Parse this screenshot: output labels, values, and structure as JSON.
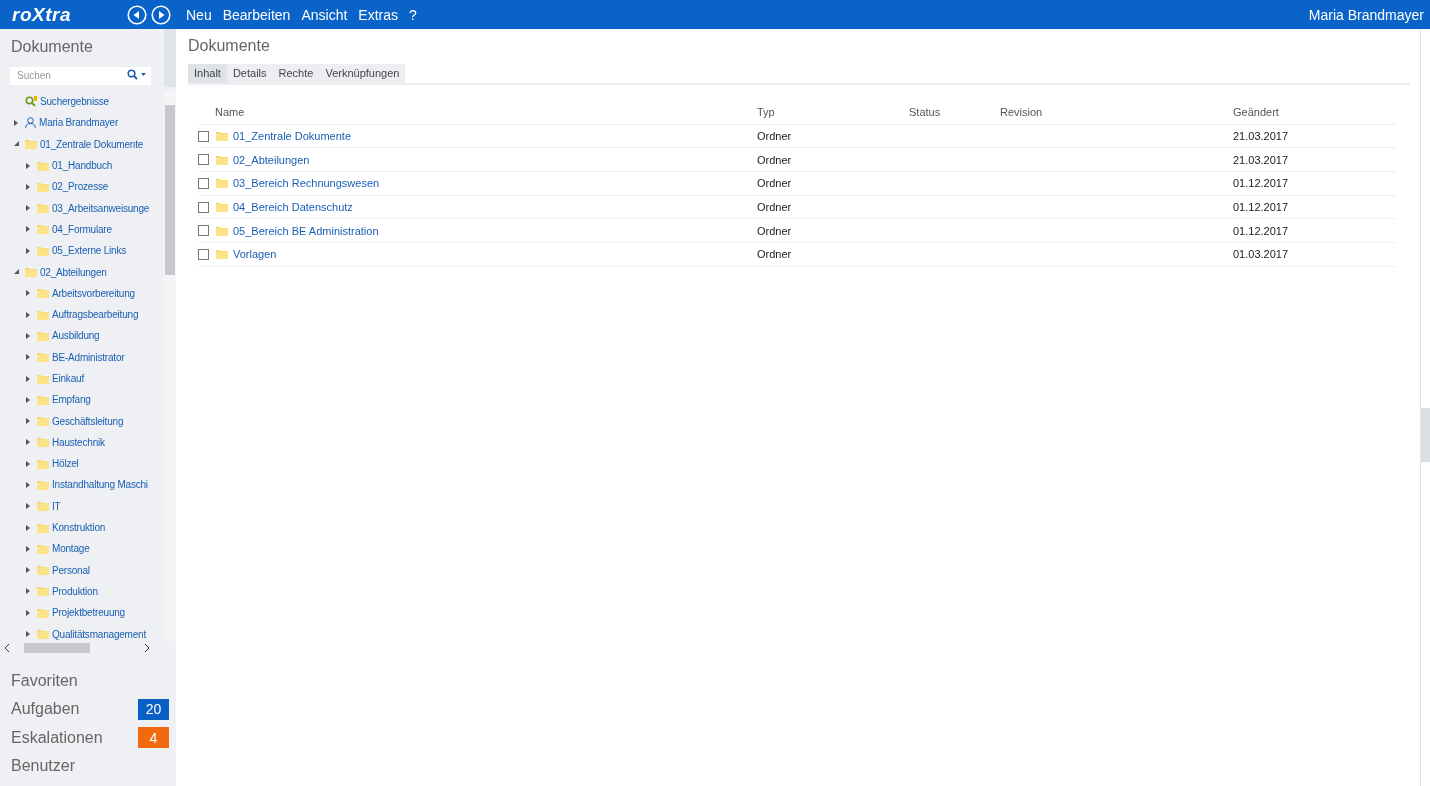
{
  "header": {
    "logo": "roXtra",
    "menu": [
      "Neu",
      "Bearbeiten",
      "Ansicht",
      "Extras",
      "?"
    ],
    "user": "Maria Brandmayer"
  },
  "sidebar": {
    "title": "Dokumente",
    "search": {
      "placeholder": "Suchen"
    },
    "tree": [
      {
        "kind": "search",
        "label": "Suchergebnisse"
      },
      {
        "kind": "user",
        "label": "Maria Brandmayer",
        "expanded": false
      },
      {
        "kind": "folder",
        "label": "01_Zentrale Dokumente",
        "expanded": true,
        "children": [
          {
            "kind": "folder",
            "label": "01_Handbuch",
            "expanded": false
          },
          {
            "kind": "folder",
            "label": "02_Prozesse",
            "expanded": false
          },
          {
            "kind": "folder",
            "label": "03_Arbeitsanweisunge",
            "expanded": false
          },
          {
            "kind": "folder",
            "label": "04_Formulare",
            "expanded": false
          },
          {
            "kind": "folder",
            "label": "05_Externe Links",
            "expanded": false
          }
        ]
      },
      {
        "kind": "folder",
        "label": "02_Abteilungen",
        "expanded": true,
        "children": [
          {
            "kind": "folder",
            "label": "Arbeitsvorbereitung",
            "expanded": false
          },
          {
            "kind": "folder",
            "label": "Auftragsbearbeitung",
            "expanded": false
          },
          {
            "kind": "folder",
            "label": "Ausbildung",
            "expanded": false
          },
          {
            "kind": "folder",
            "label": "BE-Administrator",
            "expanded": false
          },
          {
            "kind": "folder",
            "label": "Einkauf",
            "expanded": false
          },
          {
            "kind": "folder",
            "label": "Empfang",
            "expanded": false
          },
          {
            "kind": "folder",
            "label": "Geschäftsleitung",
            "expanded": false
          },
          {
            "kind": "folder",
            "label": "Haustechnik",
            "expanded": false
          },
          {
            "kind": "folder",
            "label": "Hölzel",
            "expanded": false
          },
          {
            "kind": "folder",
            "label": "Instandhaltung Maschi",
            "expanded": false
          },
          {
            "kind": "folder",
            "label": "IT",
            "expanded": false
          },
          {
            "kind": "folder",
            "label": "Konstruktion",
            "expanded": false
          },
          {
            "kind": "folder",
            "label": "Montage",
            "expanded": false
          },
          {
            "kind": "folder",
            "label": "Personal",
            "expanded": false
          },
          {
            "kind": "folder",
            "label": "Produktion",
            "expanded": false
          },
          {
            "kind": "folder",
            "label": "Projektbetreuung",
            "expanded": false
          },
          {
            "kind": "folder",
            "label": "Qualitätsmanagement",
            "expanded": false
          }
        ]
      }
    ],
    "sections": [
      {
        "label": "Favoriten"
      },
      {
        "label": "Aufgaben",
        "badge": "20",
        "color": "#0a5fc4"
      },
      {
        "label": "Eskalationen",
        "badge": "4",
        "color": "#f26a10"
      },
      {
        "label": "Benutzer"
      }
    ]
  },
  "main": {
    "title": "Dokumente",
    "tabs": [
      {
        "label": "Inhalt",
        "selected": true
      },
      {
        "label": "Details",
        "selected": false
      },
      {
        "label": "Rechte",
        "selected": false
      },
      {
        "label": "Verknüpfungen",
        "selected": false
      }
    ],
    "table": {
      "columns": [
        "Name",
        "Typ",
        "Status",
        "Revision",
        "Geändert"
      ],
      "rows": [
        {
          "name": "01_Zentrale Dokumente",
          "type": "Ordner",
          "changed": "21.03.2017",
          "checked": false
        },
        {
          "name": "02_Abteilungen",
          "type": "Ordner",
          "changed": "21.03.2017",
          "checked": false
        },
        {
          "name": "03_Bereich Rechnungswesen",
          "type": "Ordner",
          "changed": "01.12.2017",
          "checked": false
        },
        {
          "name": "04_Bereich Datenschutz",
          "type": "Ordner",
          "changed": "01.12.2017",
          "checked": false
        },
        {
          "name": "05_Bereich BE Administration",
          "type": "Ordner",
          "changed": "01.12.2017",
          "checked": false
        },
        {
          "name": "Vorlagen",
          "type": "Ordner",
          "changed": "01.03.2017",
          "checked": false
        }
      ]
    }
  }
}
